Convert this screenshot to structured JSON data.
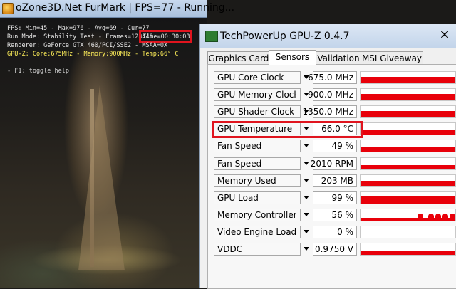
{
  "furmark": {
    "title": "oZone3D.Net FurMark | FPS=77 - Running...",
    "osd_fps": "FPS: Min=45 - Max=976 - Avg=69 - Cur=77",
    "osd_runmode": "Run Mode: Stability Test - Frames=123448 -",
    "osd_time": "Time=00:30:03",
    "osd_renderer": "Renderer: GeForce GTX 460/PCI/SSE2 - MSAA=0X",
    "osd_gpuz": "GPU-Z: Core:675MHz - Memory:900MHz - Temp:66° C",
    "osd_help": "- F1: toggle help",
    "highlight_color": "#e0141e"
  },
  "gpuz": {
    "title": "TechPowerUp GPU-Z 0.4.7",
    "close_symbol": "×",
    "tabs": [
      "Graphics Card",
      "Sensors",
      "Validation",
      "MSI Giveaway"
    ],
    "active_tab": "Sensors",
    "graph_color": "#e8000a",
    "sensors": [
      {
        "label": "GPU Core Clock",
        "value": "675.0 MHz",
        "graph_level": 0.55
      },
      {
        "label": "GPU Memory Clock",
        "value": "900.0 MHz",
        "graph_level": 0.55
      },
      {
        "label": "GPU Shader Clock",
        "value": "1350.0 MHz",
        "graph_level": 0.55
      },
      {
        "label": "GPU Temperature",
        "value": "66.0 °C",
        "graph_level": 0.4
      },
      {
        "label": "Fan Speed",
        "value": "49 %",
        "graph_level": 0.35
      },
      {
        "label": "Fan Speed",
        "value": "2010 RPM",
        "graph_level": 0.35
      },
      {
        "label": "Memory Used",
        "value": "203 MB",
        "graph_level": 0.5
      },
      {
        "label": "GPU Load",
        "value": "99 %",
        "graph_level": 0.6
      },
      {
        "label": "Memory Controller Lo...",
        "value": "56 %",
        "graph_level": 0.25
      },
      {
        "label": "Video Engine Load",
        "value": "0 %",
        "graph_level": 0.0
      },
      {
        "label": "VDDC",
        "value": "0.9750 V",
        "graph_level": 0.4
      }
    ]
  }
}
